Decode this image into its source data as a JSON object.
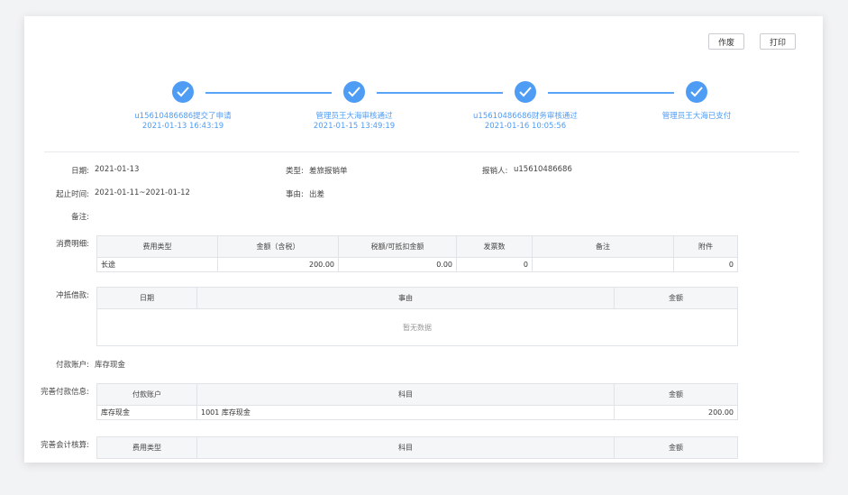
{
  "actions": {
    "void_label": "作废",
    "print_label": "打印"
  },
  "steps": [
    {
      "title": "u15610486686提交了申请",
      "time": "2021-01-13  16:43:19"
    },
    {
      "title": "管理员王大海审核通过",
      "time": "2021-01-15  13:49:19"
    },
    {
      "title": "u15610486686财务审核通过",
      "time": "2021-01-16  10:05:56"
    },
    {
      "title": "管理员王大海已支付",
      "time": ""
    }
  ],
  "info": {
    "date_label": "日期:",
    "date": "2021-01-13",
    "type_label": "类型:",
    "type": "差旅报销单",
    "reporter_label": "报销人:",
    "reporter": "u15610486686",
    "period_label": "起止时间:",
    "period": "2021-01-11~2021-01-12",
    "reason_label": "事由:",
    "reason": "出差",
    "note_label": "备注:",
    "note": ""
  },
  "expense": {
    "section_label": "消费明细:",
    "headers": [
      "费用类型",
      "金额（含税）",
      "税额/可抵扣金额",
      "发票数",
      "备注",
      "附件"
    ],
    "rows": [
      [
        "长途",
        "200.00",
        "0.00",
        "0",
        "",
        "0"
      ]
    ]
  },
  "offset": {
    "section_label": "冲抵借款:",
    "headers": [
      "日期",
      "事由",
      "金额"
    ],
    "empty_text": "暂无数据"
  },
  "payment_account": {
    "label": "付款账户:",
    "value": "库存现金"
  },
  "payment_info": {
    "section_label": "完善付款信息:",
    "headers": [
      "付款账户",
      "科目",
      "金额"
    ],
    "rows": [
      [
        "库存现金",
        "1001 库存现金",
        "200.00"
      ]
    ]
  },
  "accounting": {
    "section_label": "完善会计核算:",
    "headers": [
      "费用类型",
      "科目",
      "金额"
    ]
  },
  "colors": {
    "accent": "#4f9cf5",
    "line": "#5aa4f7",
    "header_bg": "#f5f6f7",
    "border": "#e0e3e7"
  }
}
